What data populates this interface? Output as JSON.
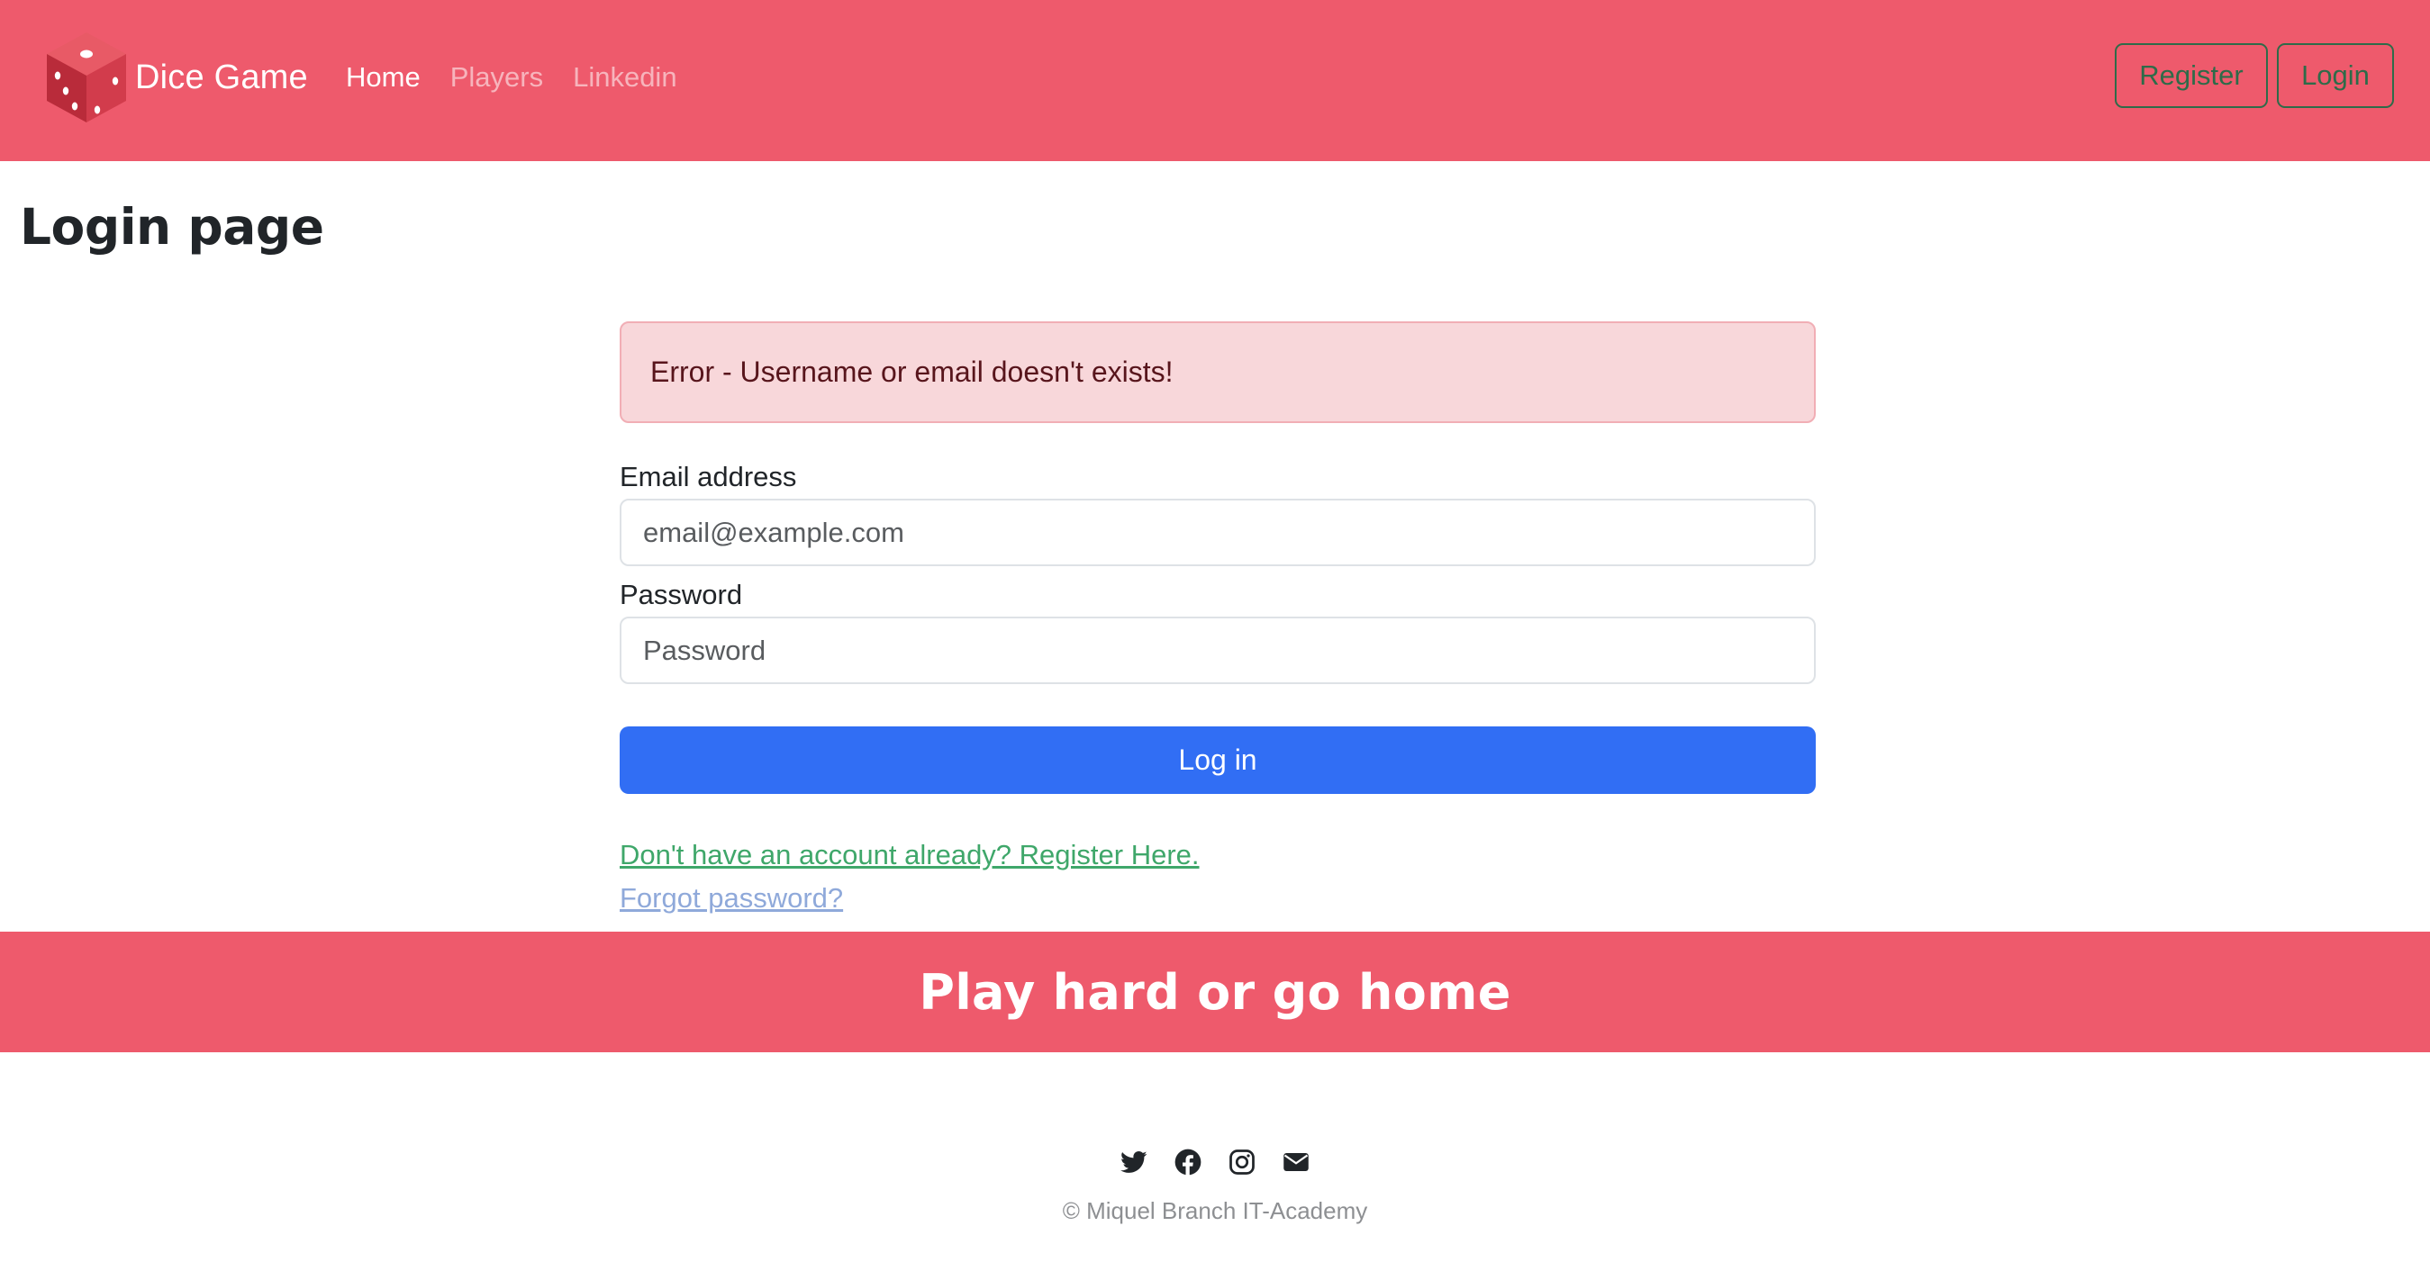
{
  "navbar": {
    "brand_name": "Dice Game",
    "links": [
      {
        "label": "Home",
        "active": true
      },
      {
        "label": "Players",
        "active": false
      },
      {
        "label": "Linkedin",
        "active": false
      }
    ],
    "register_label": "Register",
    "login_label": "Login"
  },
  "page": {
    "title": "Login page"
  },
  "form": {
    "error_message": "Error - Username or email doesn't exists!",
    "email_label": "Email address",
    "email_placeholder": "email@example.com",
    "email_value": "",
    "password_label": "Password",
    "password_placeholder": "Password",
    "password_value": "",
    "submit_label": "Log in",
    "register_link": "Don't have an account already? Register Here.",
    "forgot_link": "Forgot password?"
  },
  "banner": {
    "text": "Play hard or go home"
  },
  "footer": {
    "icons": [
      "twitter-icon",
      "facebook-icon",
      "instagram-icon",
      "envelope-icon"
    ],
    "copyright": "© Miquel Branch IT-Academy"
  },
  "colors": {
    "brand_red": "#ee5a6c",
    "primary_blue": "#316ef4",
    "outline_green": "#2e6b49",
    "link_green": "#3fa76a",
    "link_blue_muted": "#8fa9da",
    "alert_bg": "#f8d7da",
    "alert_border": "#f1aeb5",
    "alert_text": "#58151c"
  }
}
